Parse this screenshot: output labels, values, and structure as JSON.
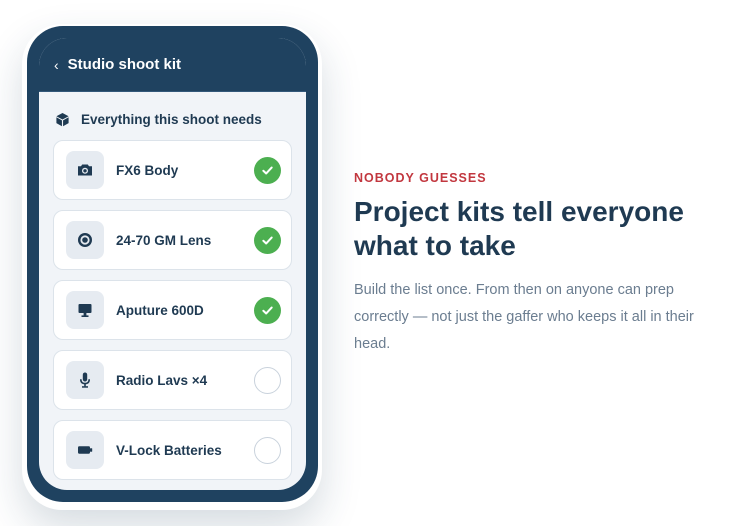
{
  "phone": {
    "back_glyph": "‹",
    "title": "Studio shoot kit",
    "section_title": "Everything this shoot needs",
    "items": [
      {
        "label": "FX6 Body",
        "icon": "camera-icon",
        "checked": true
      },
      {
        "label": "24-70 GM Lens",
        "icon": "lens-icon",
        "checked": true
      },
      {
        "label": "Aputure 600D",
        "icon": "light-icon",
        "checked": true
      },
      {
        "label": "Radio Lavs ×4",
        "icon": "microphone-icon",
        "checked": false
      },
      {
        "label": "V-Lock Batteries",
        "icon": "battery-icon",
        "checked": false
      }
    ]
  },
  "copy": {
    "eyebrow": "NOBODY GUESSES",
    "headline": "Project kits tell everyone what to take",
    "body": "Build the list once. From then on anyone can prep correctly — not just the gaffer who keeps it all in their head."
  },
  "colors": {
    "phone_frame": "#1f4260",
    "accent_red": "#c2373f",
    "check_green": "#4caf50",
    "text_dark": "#1f3a52",
    "text_muted": "#6b7d90"
  }
}
